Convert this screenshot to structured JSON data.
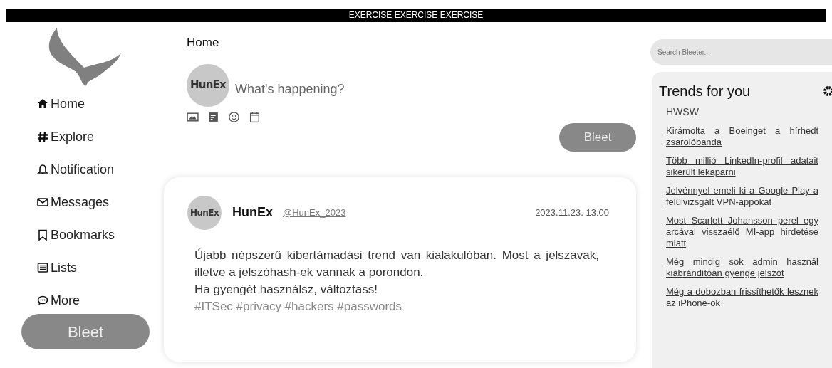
{
  "banner": "EXERCISE EXERCISE EXERCISE",
  "nav": [
    "Home",
    "Explore",
    "Notification",
    "Messages",
    "Bookmarks",
    "Lists",
    "More"
  ],
  "nav_button": "Bleet",
  "page_title": "Home",
  "composer": {
    "avatar_text": "HunEx",
    "placeholder": "What's happening?",
    "button": "Bleet"
  },
  "post": {
    "avatar_text": "HunEx",
    "name": "HunEx",
    "handle": "@HunEx_2023",
    "time": "2023.11.23. 13:00",
    "body": "Újabb népszerű kibertámadási trend van kialakulóban. Most a jelszavak, illetve a jelszóhash-ek vannak a porondon.\nHa gyengét használsz, változtass!",
    "tags": "#ITSec #privacy #hackers #passwords"
  },
  "search": {
    "placeholder": "Search Bleeter..."
  },
  "trends": {
    "title": "Trends for you",
    "source": "HWSW",
    "items": [
      "Kirámolta a Boeinget a hírhedt zsarolóbanda",
      "Több millió LinkedIn-profil adatait sikerült lekaparni",
      "Jelvénnyel emeli ki a Google Play a felülvizsgált VPN-appokat",
      "Most Scarlett Johansson perel egy arcával visszaélő MI-app hirdetése miatt",
      "Még mindig sok admin használ kiábrándítóan gyenge jelszót",
      "Még a dobozban frissíthetők lesznek az iPhone-ok"
    ]
  }
}
